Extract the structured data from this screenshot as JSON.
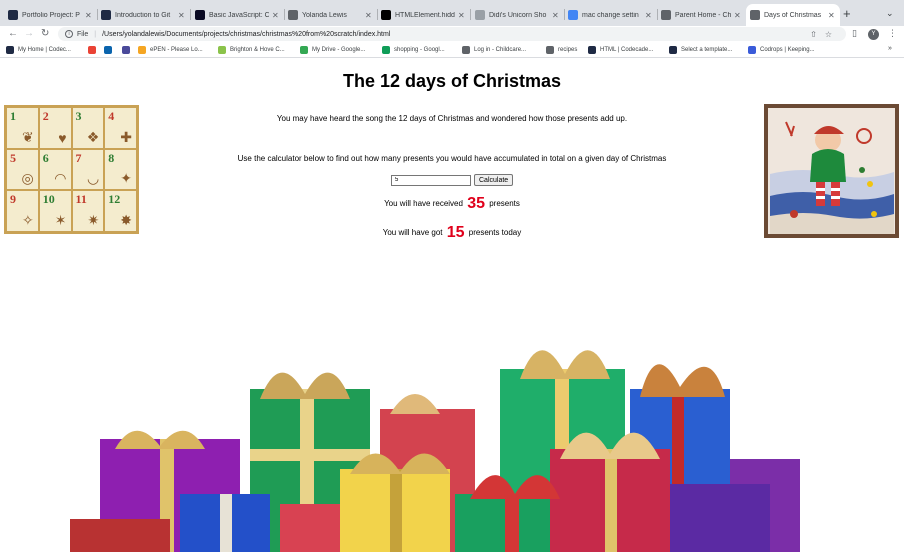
{
  "browser": {
    "tabs": [
      {
        "label": "Portfolio Project: P",
        "icon": "codecademy-icon",
        "active": false
      },
      {
        "label": "Introduction to Git",
        "icon": "codecademy-icon",
        "active": false
      },
      {
        "label": "Basic JavaScript: C",
        "icon": "freecodecamp-icon",
        "active": false
      },
      {
        "label": "Yolanda Lewis",
        "icon": "globe-icon",
        "active": false
      },
      {
        "label": "HTMLElement.hidd",
        "icon": "mdn-icon",
        "active": false
      },
      {
        "label": "Didi's Unicorn Sho",
        "icon": "shop-icon",
        "active": false
      },
      {
        "label": "mac change settin",
        "icon": "google-icon",
        "active": false
      },
      {
        "label": "Parent Home - Chi",
        "icon": "globe-icon",
        "active": false
      },
      {
        "label": "Days of Christmas",
        "icon": "globe-icon",
        "active": true
      }
    ],
    "omnibox": {
      "scheme": "File",
      "url": "/Users/yolandalewis/Documents/projects/christmas/christmas%20from%20scratch/index.html"
    },
    "profile_initial": "Y",
    "bookmarks": [
      {
        "label": "My Home | Codec...",
        "icon": "codecademy-icon",
        "color": "#1f2a44"
      },
      {
        "label": "",
        "icon": "gmail-icon",
        "color": "#ea4335"
      },
      {
        "label": "",
        "icon": "outlook-icon",
        "color": "#0a64ad"
      },
      {
        "label": "",
        "icon": "chrome-icon",
        "color": "#4a4a9a"
      },
      {
        "label": "ePEN - Please Lo...",
        "icon": "epen-icon",
        "color": "#f5a623"
      },
      {
        "label": "Brighton & Hove C...",
        "icon": "council-icon",
        "color": "#8bc34a"
      },
      {
        "label": "My Drive - Google...",
        "icon": "drive-icon",
        "color": "#34a853"
      },
      {
        "label": "shopping - Googl...",
        "icon": "sheets-icon",
        "color": "#0f9d58"
      },
      {
        "label": "Log in - Childcare...",
        "icon": "globe-icon",
        "color": "#5f6368"
      },
      {
        "label": "recipes",
        "icon": "folder-icon",
        "color": "#5f6368"
      },
      {
        "label": "HTML | Codecade...",
        "icon": "codecademy-icon",
        "color": "#1f2a44"
      },
      {
        "label": "Select a template...",
        "icon": "template-icon",
        "color": "#1f2a44"
      },
      {
        "label": "Codrops | Keeping...",
        "icon": "codrops-icon",
        "color": "#3a5bd9"
      }
    ],
    "bookmarks_more": "»"
  },
  "page": {
    "title": "The 12 days of Christmas",
    "intro": "You may have heard the song the 12 days of Christmas and wondered how those presents add up.",
    "instructions": "Use the calculator below to find out how many presents you would have accumulated in total on a given day of Christmas",
    "calculator": {
      "input_value": "5",
      "button_label": "Calculate"
    },
    "result_total": {
      "prefix": "You will have received",
      "value": "35",
      "suffix": "presents"
    },
    "result_today": {
      "prefix": "You will have got",
      "value": "15",
      "suffix": "presents today"
    },
    "day_tiles": [
      "1",
      "2",
      "3",
      "4",
      "5",
      "6",
      "7",
      "8",
      "9",
      "10",
      "11",
      "12"
    ],
    "colors": {
      "accent_red": "#e0001b"
    }
  }
}
